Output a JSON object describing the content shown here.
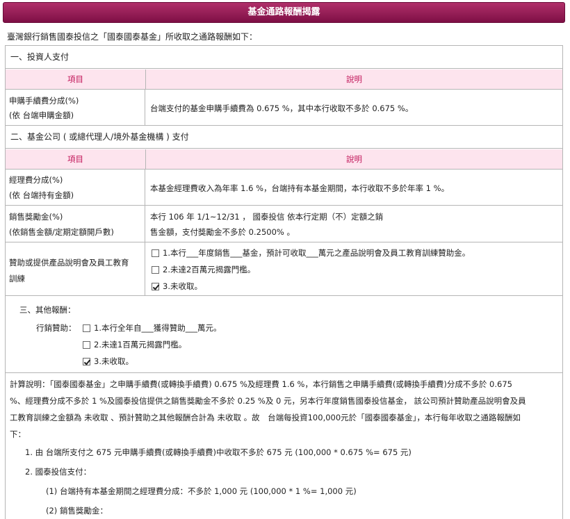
{
  "title": "基金通路報酬揭露",
  "intro": "臺灣銀行銷售國泰投信之「國泰國泰基金」所收取之通路報酬如下：",
  "table_headers": {
    "item": "項目",
    "desc": "說明"
  },
  "section1": {
    "heading": "一、投資人支付",
    "row1": {
      "label_line1": "申購手續費分成(%)",
      "label_line2": "(依 台端申購金額)",
      "desc": "台端支付的基金申購手續費為 0.675 %，其中本行收取不多於 0.675 %。"
    }
  },
  "section2": {
    "heading": "二、基金公司 ( 或總代理人/境外基金機構 ) 支付",
    "row1": {
      "label_line1": "經理費分成(%)",
      "label_line2": "(依 台端持有金額)",
      "desc": "本基金經理費收入為年率 1.6 %，台端持有本基金期間，本行收取不多於年率 1 %。"
    },
    "row2": {
      "label_line1": "銷售獎勵金(%)",
      "label_line2": "(依銷售金額/定期定額開戶數)",
      "desc_line1": "本行 106 年 1/1~12/31 ， 國泰投信 依本行定期（不）定額之銷",
      "desc_line2": "售金額，支付獎勵金不多於 0.2500% 。"
    },
    "row3": {
      "label_line1": "贊助或提供產品說明會及員工教育",
      "label_line2": "訓練",
      "options": [
        {
          "text": "1.本行___年度銷售___基金，預計可收取___萬元之產品說明會及員工教育訓練贊助金。",
          "checked": false
        },
        {
          "text": "2.未達2百萬元揭露門檻。",
          "checked": false
        },
        {
          "text": "3.未收取。",
          "checked": true
        }
      ]
    }
  },
  "section3": {
    "heading": "三、其他報酬：",
    "sub_label": "行銷贊助：",
    "options": [
      {
        "text": "1.本行全年自___獲得贊助___萬元。",
        "checked": false
      },
      {
        "text": "2.未達1百萬元揭露門檻。",
        "checked": false
      },
      {
        "text": "3.未收取。",
        "checked": true
      }
    ]
  },
  "calc": {
    "para_line1": "計算說明：「國泰國泰基金」之申購手續費(或轉換手續費) 0.675 %及經理費 1.6 %，本行銷售之申購手續費(或轉換手續費)分成不多於 0.675",
    "para_line2": "%、經理費分成不多於 1 %及國泰投信提供之銷售獎勵金不多於 0.25 %及 0 元，另本行年度銷售國泰投信基金， 該公司預計贊助產品說明會及員",
    "para_line3": "工教育訓練之金額為 未收取 、預計贊助之其他報酬合計為 未收取 。故　台端每投資100,000元於「國泰國泰基金」，本行每年收取之通路報酬如",
    "para_line4": "下：",
    "item1": "1. 由 台端所支付之 675 元申購手續費(或轉換手續費)中收取不多於 675 元 (100,000 * 0.675 %= 675 元)",
    "item2": "2. 國泰投信支付：",
    "item2_1": "(1) 台端持有本基金期間之經理費分成：不多於 1,000 元 (100,000 * 1 %= 1,000 元)",
    "item2_2": "(2) 銷售獎勵金："
  }
}
